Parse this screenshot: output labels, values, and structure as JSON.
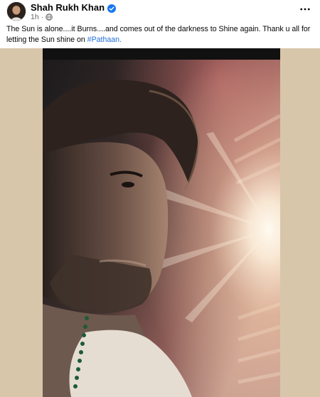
{
  "post": {
    "author": {
      "name": "Shah Rukh Khan",
      "verified_icon": "verified-badge-icon"
    },
    "meta": {
      "time": "1h",
      "separator": "·",
      "audience_icon": "globe-icon"
    },
    "more_icon": "more-horizontal-icon",
    "caption": {
      "text": "The Sun is alone....it Burns....and comes out of the darkness to Shine again.  Thank u all for letting the Sun shine on ",
      "hashtag": "#Pathaan."
    },
    "media": {
      "type": "photo"
    },
    "colors": {
      "hashtag": "#216fdb",
      "verified": "#1877f2",
      "meta": "#65676b",
      "media_background": "#d8c6ab"
    }
  }
}
